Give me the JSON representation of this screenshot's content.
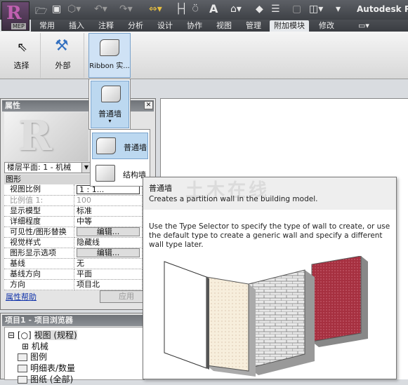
{
  "app": {
    "title": "Autodesk Re",
    "badge": "MEP",
    "logo": "R"
  },
  "tabs": [
    "常用",
    "插入",
    "注释",
    "分析",
    "设计",
    "协作",
    "视图",
    "管理",
    "附加模块",
    "修改"
  ],
  "active_tab": "附加模块",
  "ribbon": {
    "buttons": [
      {
        "label": "选择",
        "icon": "cursor-icon"
      },
      {
        "label": "外部",
        "icon": "tools-icon"
      },
      {
        "label": "Ribbon 实...",
        "icon": "wall-icon"
      }
    ]
  },
  "dropdown": {
    "label": "普通墙"
  },
  "flyout": {
    "items": [
      {
        "label": "普通墙"
      },
      {
        "label": "结构墙"
      }
    ]
  },
  "properties": {
    "title": "属性",
    "type_selector": "楼层平面: 1 - 机械",
    "group": "图形",
    "rows": [
      {
        "name": "视图比例",
        "value": "1 : 1..."
      },
      {
        "name": "比例值 1:",
        "value": "100"
      },
      {
        "name": "显示模型",
        "value": "标准"
      },
      {
        "name": "详细程度",
        "value": "中等"
      },
      {
        "name": "可见性/图形替换",
        "value": "编辑..."
      },
      {
        "name": "视觉样式",
        "value": "隐藏线"
      },
      {
        "name": "图形显示选项",
        "value": "编辑..."
      },
      {
        "name": "基线",
        "value": "无"
      },
      {
        "name": "基线方向",
        "value": "平面"
      },
      {
        "name": "方向",
        "value": "项目北"
      }
    ],
    "help": "属性帮助",
    "apply": "应用"
  },
  "browser": {
    "title": "项目1 - 项目浏览器",
    "nodes": [
      "视图 (规程)",
      "机械",
      "图例",
      "明细表/数量",
      "图纸 (全部)"
    ]
  },
  "tooltip": {
    "title": "普通墙",
    "subtitle": "Creates a partition wall in the building model.",
    "body": "Use the Type Selector to specify the type of wall to create, or use the default type to create a generic wall and specify a different wall type later.",
    "watermark": "土木在线"
  }
}
